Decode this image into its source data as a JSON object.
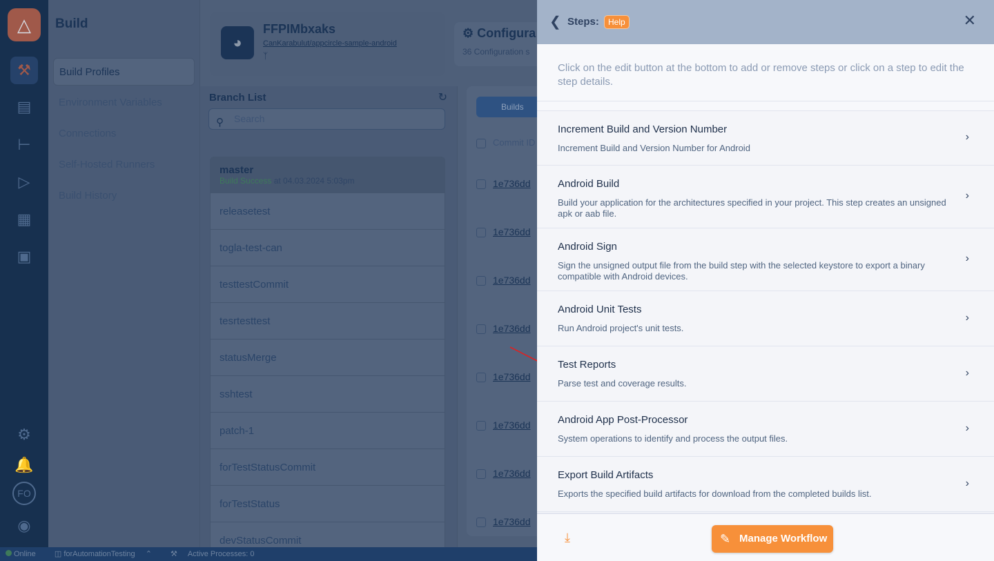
{
  "nav": {
    "icons": [
      "appcircle-logo-icon",
      "build-hammer-icon",
      "signing-identities-icon",
      "distribution-icon",
      "testing-distribution-icon",
      "store-submit-icon",
      "enterprise-store-icon",
      "settings-gear-icon",
      "notification-bell-icon",
      "avatar",
      "user-icon"
    ],
    "avatar_initials": "FO",
    "accent": "#e8754f"
  },
  "sub": {
    "title": "Build",
    "items": [
      "Build Profiles",
      "Environment Variables",
      "Connections",
      "Self-Hosted Runners",
      "Build History"
    ]
  },
  "profile": {
    "name": "FFPIMbxaks",
    "repo": "CanKarabulut/appcircle-sample-android",
    "config_title": "Configura",
    "config_sub": "36 Configuration s"
  },
  "branches": {
    "title": "Branch List",
    "search_placeholder": "Search",
    "master": {
      "name": "master",
      "status": "Build Success",
      "at": " at 04.03.2024 5:03pm"
    },
    "items": [
      "releasetest",
      "togla-test-can",
      "testtestCommit",
      "tesrtesttest",
      "statusMerge",
      "sshtest",
      "patch-1",
      "forTestStatusCommit",
      "forTestStatus",
      "devStatusCommit"
    ]
  },
  "builds": {
    "tab": "Builds",
    "col_commit": "Commit ID",
    "commits": [
      "1e736dd",
      "1e736dd",
      "1e736dd",
      "1e736dd",
      "1e736dd",
      "1e736dd",
      "1e736dd",
      "1e736dd"
    ]
  },
  "status_bar": {
    "online": "Online",
    "org": "forAutomationTesting",
    "processes": "Active Processes: 0"
  },
  "drawer": {
    "title": "Steps:",
    "help": "Help",
    "intro": "Click on the edit button at the bottom to add or remove steps or click on a step to edit the step details.",
    "steps": [
      {
        "title": "Increment Build and Version Number",
        "desc": "Increment Build and Version Number for Android"
      },
      {
        "title": "Android Build",
        "desc": "Build your application for the architectures specified in your project. This step creates an unsigned apk or aab file."
      },
      {
        "title": "Android Sign",
        "desc": "Sign the unsigned output file from the build step with the selected keystore to export a binary compatible with Android devices."
      },
      {
        "title": "Android Unit Tests",
        "desc": "Run Android project's unit tests."
      },
      {
        "title": "Test Reports",
        "desc": "Parse test and coverage results."
      },
      {
        "title": "Android App Post-Processor",
        "desc": "System operations to identify and process the output files."
      },
      {
        "title": "Export Build Artifacts",
        "desc": "Exports the specified build artifacts for download from the completed builds list."
      }
    ],
    "manage": "Manage Workflow",
    "accent": "#f7903a"
  }
}
